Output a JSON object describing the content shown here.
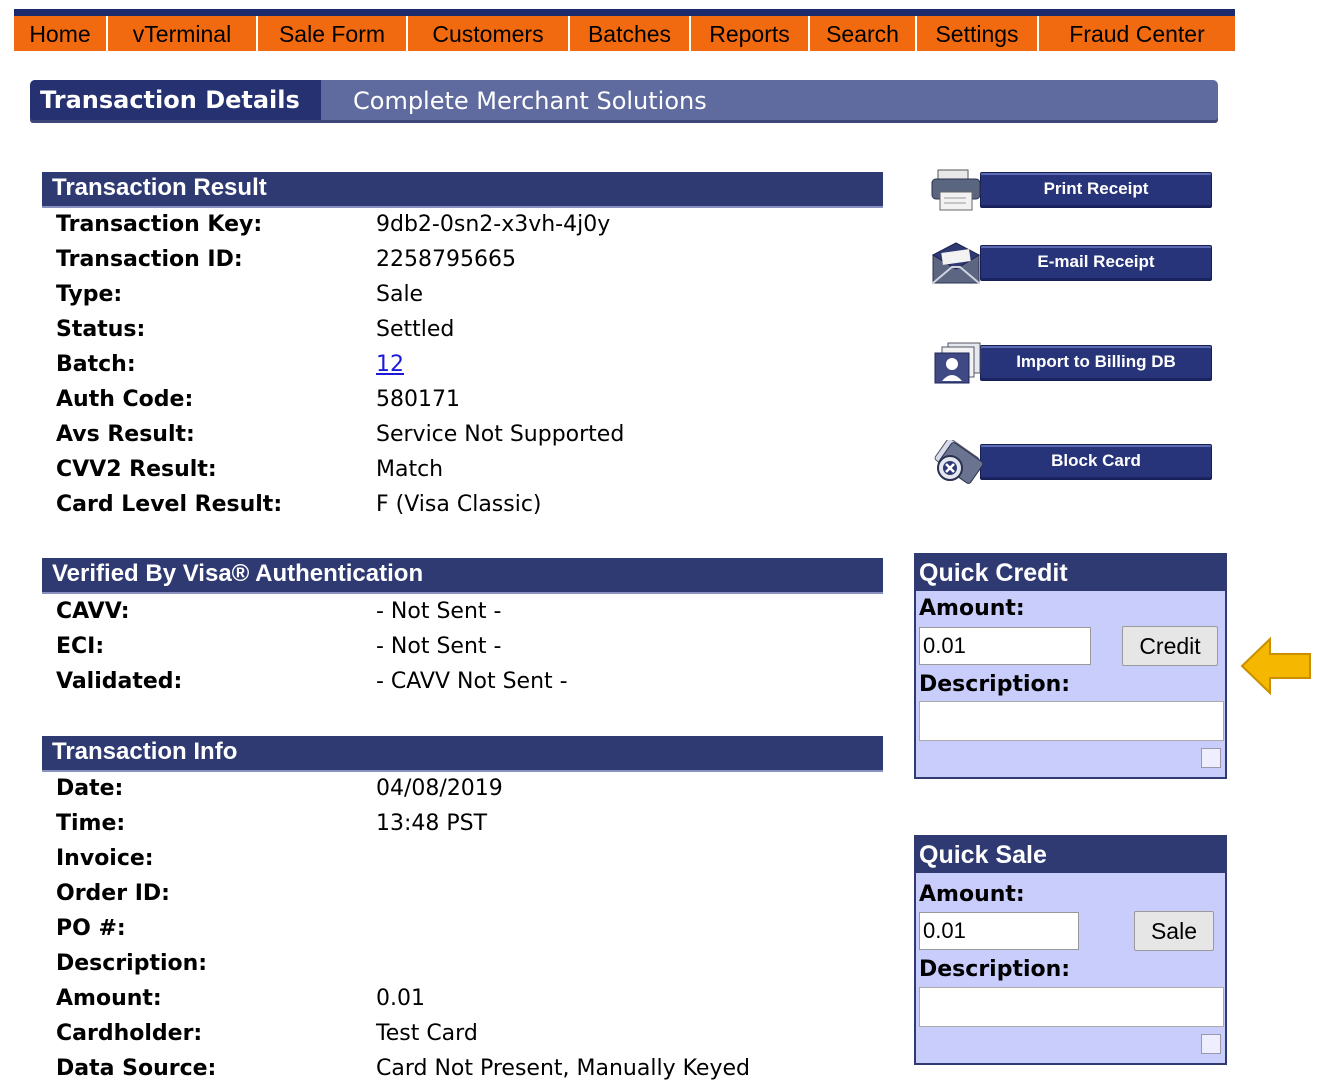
{
  "nav": [
    "Home",
    "vTerminal",
    "Sale Form",
    "Customers",
    "Batches",
    "Reports",
    "Search",
    "Settings",
    "Fraud Center"
  ],
  "header": {
    "tab": "Transaction Details",
    "subtitle": "Complete Merchant Solutions"
  },
  "result": {
    "title": "Transaction Result",
    "rows": [
      {
        "label": "Transaction Key:",
        "value": "9db2-0sn2-x3vh-4j0y"
      },
      {
        "label": "Transaction ID:",
        "value": "2258795665"
      },
      {
        "label": "Type:",
        "value": "Sale"
      },
      {
        "label": "Status:",
        "value": "Settled"
      },
      {
        "label": "Batch:",
        "value": "12"
      },
      {
        "label": "Auth Code:",
        "value": "580171"
      },
      {
        "label": "Avs Result:",
        "value": "Service Not Supported"
      },
      {
        "label": "CVV2 Result:",
        "value": "Match"
      },
      {
        "label": "Card Level Result:",
        "value": "F (Visa Classic)"
      }
    ]
  },
  "vbv": {
    "title": "Verified By Visa® Authentication",
    "rows": [
      {
        "label": "CAVV:",
        "value": "- Not Sent -"
      },
      {
        "label": "ECI:",
        "value": "- Not Sent -"
      },
      {
        "label": "Validated:",
        "value": "- CAVV Not Sent -"
      }
    ]
  },
  "info": {
    "title": "Transaction Info",
    "rows": [
      {
        "label": "Date:",
        "value": "04/08/2019"
      },
      {
        "label": "Time:",
        "value": "13:48 PST"
      },
      {
        "label": "Invoice:",
        "value": ""
      },
      {
        "label": "Order ID:",
        "value": ""
      },
      {
        "label": "PO #:",
        "value": ""
      },
      {
        "label": "Description:",
        "value": ""
      },
      {
        "label": "Amount:",
        "value": "0.01"
      },
      {
        "label": "Cardholder:",
        "value": "Test Card"
      },
      {
        "label": "Data Source:",
        "value": "Card Not Present, Manually Keyed"
      }
    ]
  },
  "actions": {
    "print": "Print Receipt",
    "email": "E-mail Receipt",
    "import": "Import to Billing DB",
    "block": "Block Card"
  },
  "quick_credit": {
    "title": "Quick Credit",
    "amount_label": "Amount:",
    "amount": "0.01",
    "button": "Credit",
    "desc_label": "Description:"
  },
  "quick_sale": {
    "title": "Quick Sale",
    "amount_label": "Amount:",
    "amount": "0.01",
    "button": "Sale",
    "desc_label": "Description:"
  },
  "colors": {
    "nav": "#f26a10",
    "header": "#2f3a73",
    "panel": "#c9cdfb",
    "arrow": "#f5b700"
  }
}
